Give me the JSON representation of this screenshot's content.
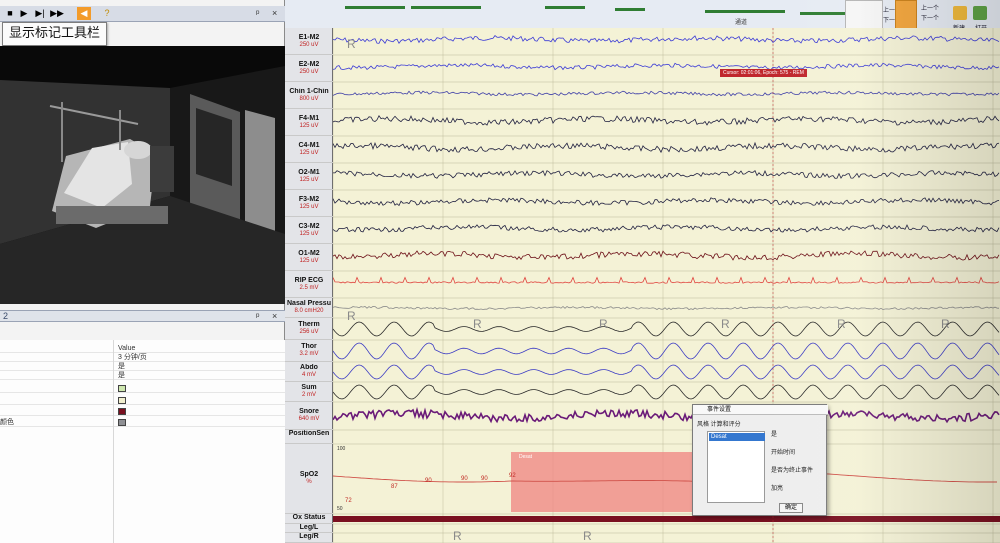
{
  "video": {
    "marker_toolbar_tooltip": "显示标记工具栏",
    "toolbar_icons": [
      "stop-icon",
      "play-icon",
      "step-forward-icon",
      "fast-forward-icon",
      "marker-toolbar-icon",
      "help-icon"
    ]
  },
  "properties": {
    "panel_number": "2",
    "value_header": "Value",
    "rows": [
      {
        "name": "",
        "value": "3 分钟/页"
      },
      {
        "name": "",
        "value": "是"
      },
      {
        "name": "",
        "value": "是"
      },
      {
        "name": "",
        "swatch": "#cfe8b0"
      },
      {
        "name": "",
        "swatch": "#f1efcf"
      },
      {
        "name": "",
        "swatch": "#7a1020"
      },
      {
        "name": "颜色",
        "swatch": "#8f9094"
      }
    ]
  },
  "ribbon": {
    "group_label": "通道",
    "buttons": [
      "上一个",
      "下一个",
      "上一个",
      "下一个",
      "新建",
      "打开"
    ]
  },
  "cursor_label": "Cursor: 02:01:06, Epoch: 575 - REM",
  "channels": [
    {
      "name": "E1-M2",
      "scale": "250 uV"
    },
    {
      "name": "E2-M2",
      "scale": "250 uV"
    },
    {
      "name": "Chin 1-Chin",
      "scale": "800 uV"
    },
    {
      "name": "F4-M1",
      "scale": "125 uV"
    },
    {
      "name": "C4-M1",
      "scale": "125 uV"
    },
    {
      "name": "O2-M1",
      "scale": "125 uV"
    },
    {
      "name": "F3-M2",
      "scale": "125 uV"
    },
    {
      "name": "C3-M2",
      "scale": "125 uV"
    },
    {
      "name": "O1-M2",
      "scale": "125 uV"
    },
    {
      "name": "RIP ECG",
      "scale": "2.5 mV"
    },
    {
      "name": "Nasal Pressu",
      "scale": "8.0 cmH20"
    },
    {
      "name": "Therm",
      "scale": "256 uV"
    },
    {
      "name": "Thor",
      "scale": "3.2 mV"
    },
    {
      "name": "Abdo",
      "scale": "4 mV"
    },
    {
      "name": "Sum",
      "scale": "2 mV"
    },
    {
      "name": "Snore",
      "scale": "640 mV"
    },
    {
      "name": "PositionSen",
      "scale": ""
    },
    {
      "name": "SpO2",
      "scale": "%"
    },
    {
      "name": "Ox Status",
      "scale": ""
    },
    {
      "name": "Leg/L",
      "scale": ""
    },
    {
      "name": "Leg/R",
      "scale": ""
    }
  ],
  "spo2": {
    "axis_top": "100",
    "axis_bottom": "50",
    "readings": [
      "72",
      "87",
      "90",
      "90",
      "90",
      "92"
    ],
    "desat_label": "Desat"
  },
  "stage_marker": "R",
  "event_dialog": {
    "title": "事件设置",
    "tabs": "风格  计算和评分",
    "list_items": [
      "Desat",
      "",
      "",
      "",
      ""
    ],
    "selected_index": 0,
    "options": [
      "是",
      "",
      "开始时间",
      "",
      "是否为终止事件",
      "",
      "加亮"
    ],
    "ok_label": "确定"
  }
}
